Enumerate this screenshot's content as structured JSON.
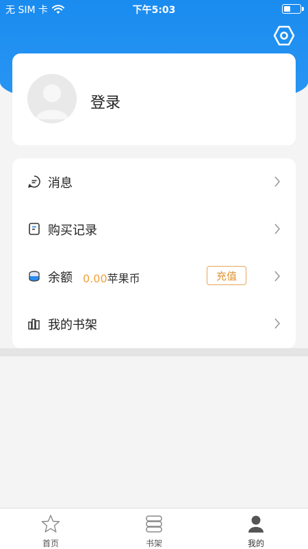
{
  "status_bar": {
    "carrier": "无 SIM 卡",
    "time": "下午5:03",
    "battery_level": 0.45
  },
  "icons": {
    "settings": "settings-hexagon-icon",
    "avatar": "default-avatar-icon",
    "message": "message-bubble-icon",
    "purchase": "receipt-icon",
    "balance": "coins-icon",
    "bookshelf": "bookshelf-icon",
    "chevron": "chevron-right-icon"
  },
  "colors": {
    "brand": "#1a8cf0",
    "accent": "#f0a23c",
    "button_border": "#e5a55a"
  },
  "profile": {
    "login_label": "登录"
  },
  "menu": {
    "items": [
      {
        "label": "消息"
      },
      {
        "label": "购买记录"
      },
      {
        "label": "余额",
        "balance_value": "0.00",
        "balance_unit": "苹果币",
        "button_label": "充值"
      },
      {
        "label": "我的书架"
      }
    ]
  },
  "tabbar": {
    "tabs": [
      {
        "label": "首页"
      },
      {
        "label": "书架"
      },
      {
        "label": "我的"
      }
    ],
    "active_index": 2
  }
}
